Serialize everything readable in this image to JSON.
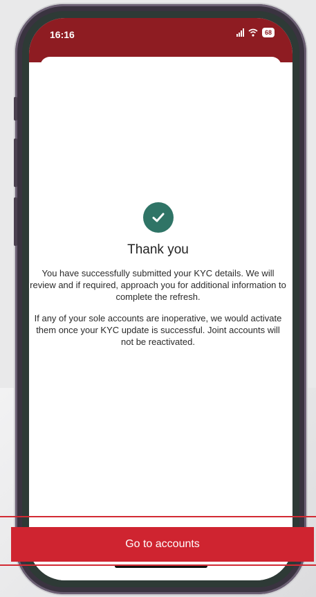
{
  "status_bar": {
    "time": "16:16",
    "battery": "68"
  },
  "confirmation": {
    "title": "Thank you",
    "message_1": "You have successfully submitted your KYC details. We will review and if required, approach you for additional information to complete the refresh.",
    "message_2": "If any of your sole accounts are inoperative, we would activate them once your KYC update is successful. Joint accounts will not be reactivated."
  },
  "actions": {
    "primary_label": "Go to accounts"
  },
  "colors": {
    "brand_red": "#cf2430",
    "status_bar_red": "#8e1c22",
    "success_green": "#2f7466"
  },
  "icons": [
    "check-icon",
    "signal-icon",
    "wifi-icon",
    "battery-icon"
  ]
}
